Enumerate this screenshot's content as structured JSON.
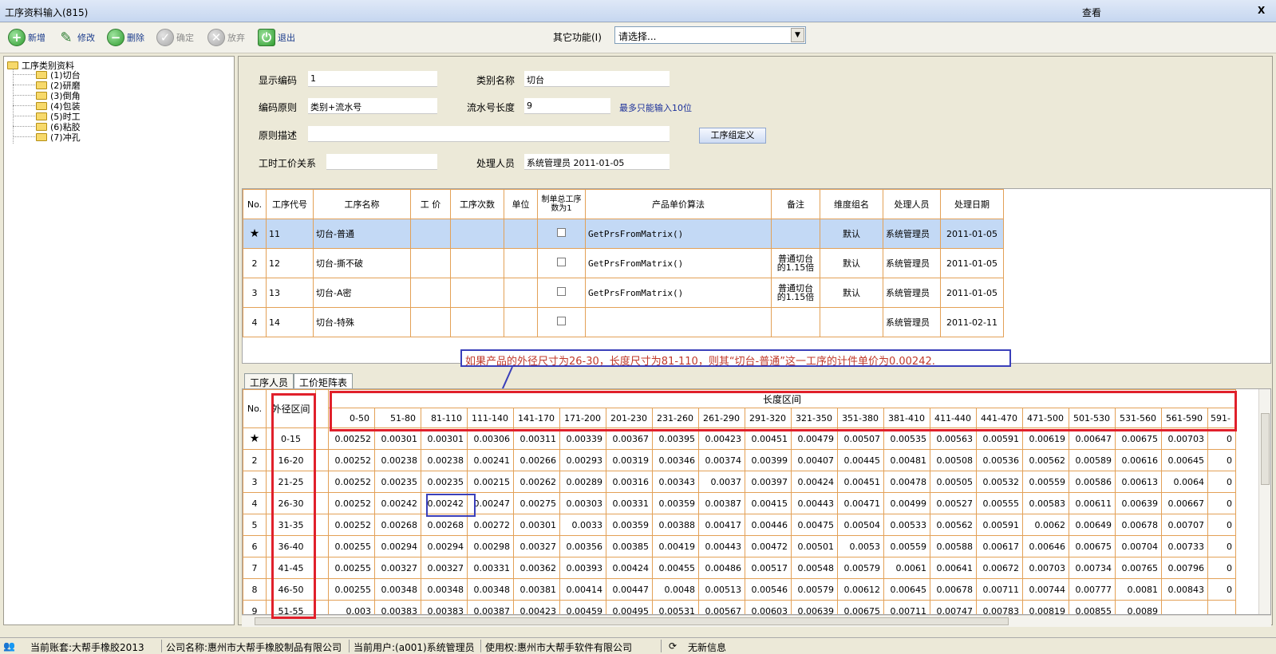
{
  "window": {
    "title": "工序资料输入(815)",
    "view_label": "查看",
    "close_label": "X"
  },
  "toolbar": {
    "add": "新增",
    "edit": "修改",
    "delete": "删除",
    "confirm": "确定",
    "discard": "放弃",
    "exit": "退出",
    "other_label": "其它功能(I)",
    "other_value": "请选择..."
  },
  "tree": {
    "root": "工序类别资料",
    "items": [
      "(1)切台",
      "(2)研磨",
      "(3)倒角",
      "(4)包装",
      "(5)时工",
      "(6)粘胶",
      "(7)冲孔"
    ]
  },
  "form": {
    "display_code_label": "显示编码",
    "display_code": "1",
    "category_name_label": "类别名称",
    "category_name": "切台",
    "rule_label": "编码原则",
    "rule": "类别+流水号",
    "serial_len_label": "流水号长度",
    "serial_len": "9",
    "max_note": "最多只能输入10位",
    "rule_desc_label": "原则描述",
    "rule_desc": "",
    "group_def_button": "工序组定义",
    "labor_rel_label": "工时工价关系",
    "labor_rel": "",
    "handler_label": "处理人员",
    "handler": "系统管理员   2011-01-05"
  },
  "upper_grid": {
    "headers": [
      "No.",
      "工序代号",
      "工序名称",
      "工  价",
      "工序次数",
      "单位",
      "制单总工序数为1",
      "产品单价算法",
      "备注",
      "维度组名",
      "处理人员",
      "处理日期"
    ],
    "rows": [
      {
        "no": "★",
        "code": "11",
        "name": "切台-普通",
        "price": "",
        "times": "",
        "unit": "",
        "algo": "GetPrsFromMatrix()",
        "note": "",
        "dim": "默认",
        "handler": "系统管理员",
        "date": "2011-01-05"
      },
      {
        "no": "2",
        "code": "12",
        "name": "切台-撕不破",
        "price": "",
        "times": "",
        "unit": "",
        "algo": "GetPrsFromMatrix()",
        "note": "普通切台的1.15倍",
        "dim": "默认",
        "handler": "系统管理员",
        "date": "2011-01-05"
      },
      {
        "no": "3",
        "code": "13",
        "name": "切台-A密",
        "price": "",
        "times": "",
        "unit": "",
        "algo": "GetPrsFromMatrix()",
        "note": "普通切台的1.15倍",
        "dim": "默认",
        "handler": "系统管理员",
        "date": "2011-01-05"
      },
      {
        "no": "4",
        "code": "14",
        "name": "切台-特殊",
        "price": "",
        "times": "",
        "unit": "",
        "algo": "",
        "note": "",
        "dim": "",
        "handler": "系统管理员",
        "date": "2011-02-11"
      }
    ]
  },
  "annotation": "如果产品的外径尺寸为26-30，长度尺寸为81-110，则其“切台-普通”这一工序的计件单价为0.00242.",
  "tabs": [
    "工序人员",
    "工价矩阵表"
  ],
  "matrix": {
    "no_header": "No.",
    "row_header": "外径区间",
    "group_header": "长度区间",
    "columns": [
      "0-50",
      "51-80",
      "81-110",
      "111-140",
      "141-170",
      "171-200",
      "201-230",
      "231-260",
      "261-290",
      "291-320",
      "321-350",
      "351-380",
      "381-410",
      "411-440",
      "441-470",
      "471-500",
      "501-530",
      "531-560",
      "561-590",
      "591-"
    ],
    "rows": [
      {
        "no": "★",
        "range": "0-15",
        "values": [
          "0.00252",
          "0.00301",
          "0.00301",
          "0.00306",
          "0.00311",
          "0.00339",
          "0.00367",
          "0.00395",
          "0.00423",
          "0.00451",
          "0.00479",
          "0.00507",
          "0.00535",
          "0.00563",
          "0.00591",
          "0.00619",
          "0.00647",
          "0.00675",
          "0.00703",
          "0"
        ]
      },
      {
        "no": "2",
        "range": "16-20",
        "values": [
          "0.00252",
          "0.00238",
          "0.00238",
          "0.00241",
          "0.00266",
          "0.00293",
          "0.00319",
          "0.00346",
          "0.00374",
          "0.00399",
          "0.00407",
          "0.00445",
          "0.00481",
          "0.00508",
          "0.00536",
          "0.00562",
          "0.00589",
          "0.00616",
          "0.00645",
          "0"
        ]
      },
      {
        "no": "3",
        "range": "21-25",
        "values": [
          "0.00252",
          "0.00235",
          "0.00235",
          "0.00215",
          "0.00262",
          "0.00289",
          "0.00316",
          "0.00343",
          "0.0037",
          "0.00397",
          "0.00424",
          "0.00451",
          "0.00478",
          "0.00505",
          "0.00532",
          "0.00559",
          "0.00586",
          "0.00613",
          "0.0064",
          "0"
        ]
      },
      {
        "no": "4",
        "range": "26-30",
        "values": [
          "0.00252",
          "0.00242",
          "0.00242",
          "0.00247",
          "0.00275",
          "0.00303",
          "0.00331",
          "0.00359",
          "0.00387",
          "0.00415",
          "0.00443",
          "0.00471",
          "0.00499",
          "0.00527",
          "0.00555",
          "0.00583",
          "0.00611",
          "0.00639",
          "0.00667",
          "0"
        ]
      },
      {
        "no": "5",
        "range": "31-35",
        "values": [
          "0.00252",
          "0.00268",
          "0.00268",
          "0.00272",
          "0.00301",
          "0.0033",
          "0.00359",
          "0.00388",
          "0.00417",
          "0.00446",
          "0.00475",
          "0.00504",
          "0.00533",
          "0.00562",
          "0.00591",
          "0.0062",
          "0.00649",
          "0.00678",
          "0.00707",
          "0"
        ]
      },
      {
        "no": "6",
        "range": "36-40",
        "values": [
          "0.00255",
          "0.00294",
          "0.00294",
          "0.00298",
          "0.00327",
          "0.00356",
          "0.00385",
          "0.00419",
          "0.00443",
          "0.00472",
          "0.00501",
          "0.0053",
          "0.00559",
          "0.00588",
          "0.00617",
          "0.00646",
          "0.00675",
          "0.00704",
          "0.00733",
          "0"
        ]
      },
      {
        "no": "7",
        "range": "41-45",
        "values": [
          "0.00255",
          "0.00327",
          "0.00327",
          "0.00331",
          "0.00362",
          "0.00393",
          "0.00424",
          "0.00455",
          "0.00486",
          "0.00517",
          "0.00548",
          "0.00579",
          "0.0061",
          "0.00641",
          "0.00672",
          "0.00703",
          "0.00734",
          "0.00765",
          "0.00796",
          "0"
        ]
      },
      {
        "no": "8",
        "range": "46-50",
        "values": [
          "0.00255",
          "0.00348",
          "0.00348",
          "0.00348",
          "0.00381",
          "0.00414",
          "0.00447",
          "0.0048",
          "0.00513",
          "0.00546",
          "0.00579",
          "0.00612",
          "0.00645",
          "0.00678",
          "0.00711",
          "0.00744",
          "0.00777",
          "0.0081",
          "0.00843",
          "0"
        ]
      },
      {
        "no": "9",
        "range": "51-55",
        "values": [
          "0.003",
          "0.00383",
          "0.00383",
          "0.00387",
          "0.00423",
          "0.00459",
          "0.00495",
          "0.00531",
          "0.00567",
          "0.00603",
          "0.00639",
          "0.00675",
          "0.00711",
          "0.00747",
          "0.00783",
          "0.00819",
          "0.00855",
          "0.0089",
          "",
          ""
        ]
      }
    ]
  },
  "status": {
    "account": "当前账套:大帮手橡胶2013",
    "company": "公司名称:惠州市大帮手橡胶制品有限公司",
    "user": "当前用户:(a001)系统管理员",
    "license": "使用权:惠州市大帮手软件有限公司",
    "message": "无新信息"
  },
  "colors": {
    "highlight_red": "#e0202b",
    "highlight_blue": "#3a3fba",
    "grid_border": "#e3a157",
    "selected_row": "#c3d9f5"
  }
}
